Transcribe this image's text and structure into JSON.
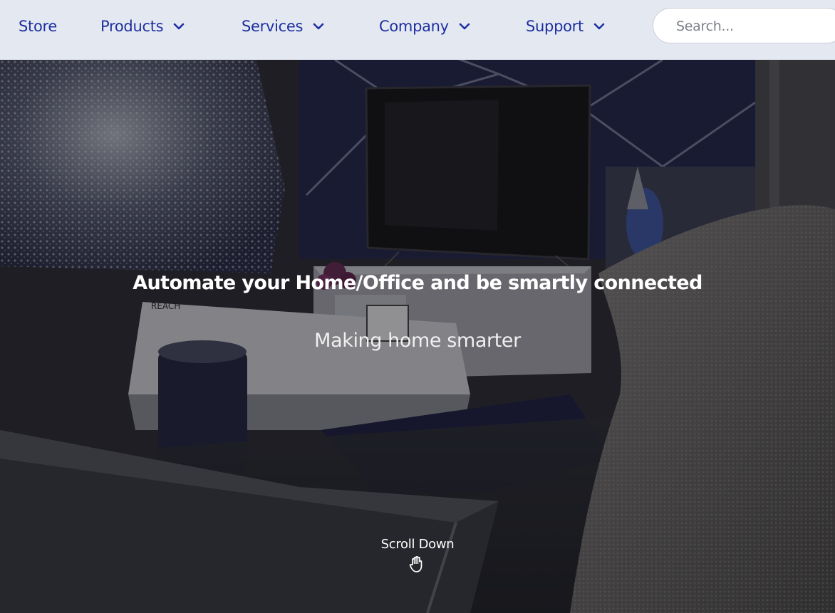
{
  "nav": {
    "store": "Store",
    "products": "Products",
    "services": "Services",
    "company": "Company",
    "support": "Support"
  },
  "search": {
    "placeholder": "Search..."
  },
  "hero": {
    "title": "Automate your Home/Office and be smartly connected",
    "subtitle": "Making home smarter",
    "scroll_label": "Scroll Down",
    "scroll_icon": "hand-icon"
  },
  "colors": {
    "nav_bg": "#e4e9f1",
    "nav_text": "#1d2fa0",
    "hero_overlay": "#1c1c20"
  }
}
